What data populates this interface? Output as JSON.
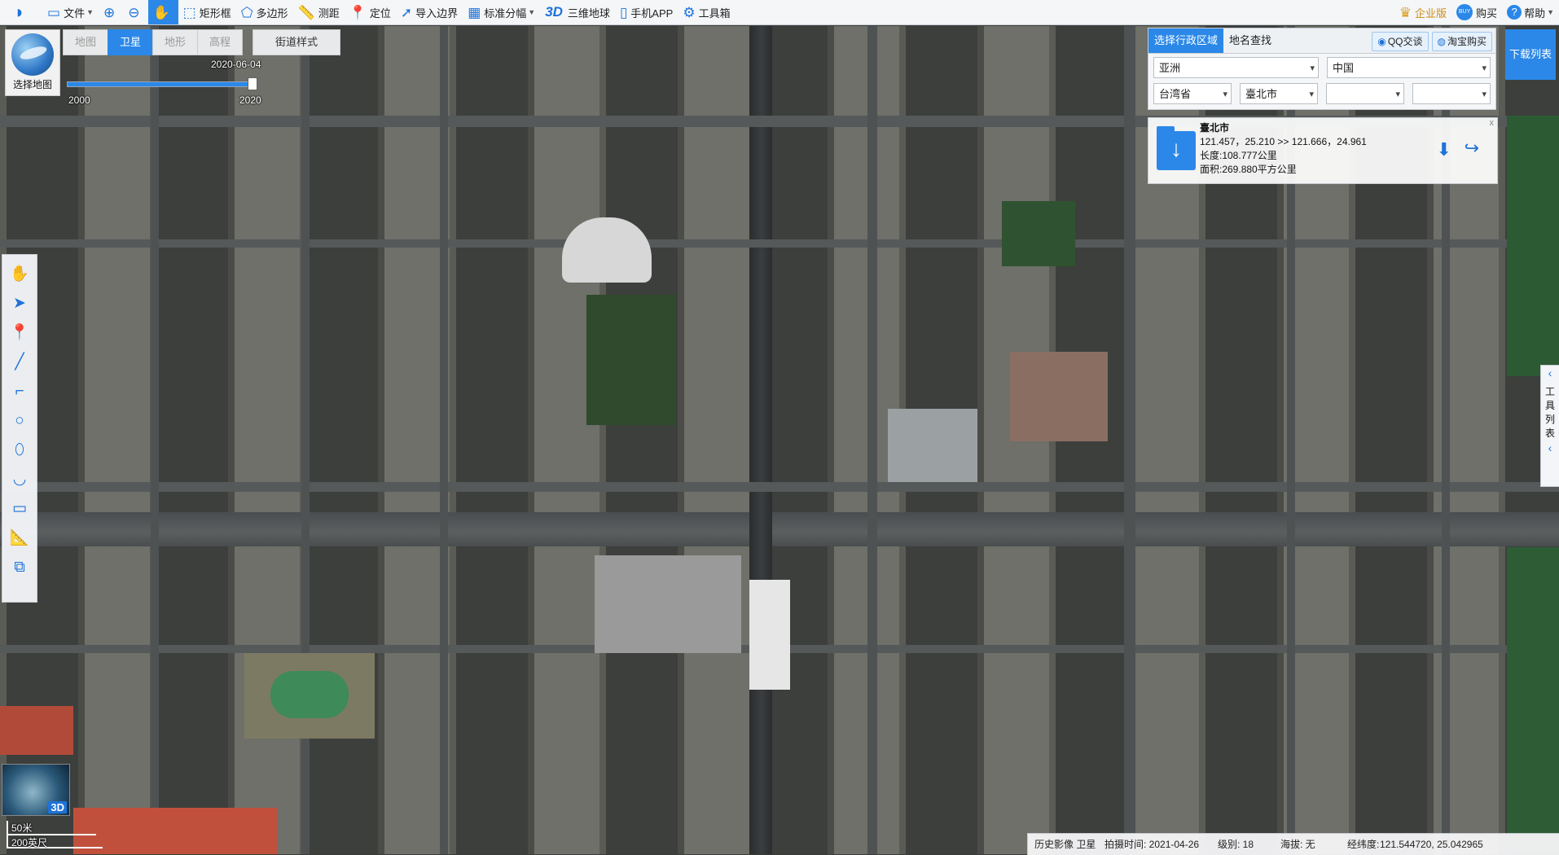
{
  "toolbar": {
    "file": "文件",
    "zoom_in": "",
    "zoom_out": "",
    "rect_frame": "矩形框",
    "polygon": "多边形",
    "measure": "测距",
    "locate": "定位",
    "import_boundary": "导入边界",
    "standard_grid": "标准分幅",
    "threeD_badge": "3D",
    "threeD_globe": "三维地球",
    "mobile_app": "手机APP",
    "toolbox": "工具箱",
    "enterprise": "企业版",
    "buy_badge": "BUY",
    "buy": "购买",
    "help": "帮助"
  },
  "map_selector": {
    "label": "选择地图"
  },
  "map_tabs": [
    "地图",
    "卫星",
    "地形",
    "高程"
  ],
  "active_map_tab": "卫星",
  "street_style": "街道样式",
  "timeline": {
    "current_date": "2020-06-04",
    "start_year": "2000",
    "end_year": "2020",
    "position": 1.0
  },
  "left_tools": [
    "hand-icon",
    "pointer-icon",
    "marker-icon",
    "line-icon",
    "polyline-icon",
    "circle-icon",
    "ellipse-icon",
    "curve-icon",
    "rectangle-icon",
    "ruler-icon",
    "area-icon"
  ],
  "region_panel": {
    "tab_region": "选择行政区域",
    "tab_place": "地名查找",
    "qq_chat": "QQ交谈",
    "taobao": "淘宝购买",
    "continent": "亚洲",
    "country": "中国",
    "province": "台湾省",
    "city": "臺北市",
    "district": "",
    "town": ""
  },
  "info_card": {
    "name": "臺北市",
    "coords": "121.457，25.210 >> 121.666，24.961",
    "length": "长度:108.777公里",
    "area": "面积:269.880平方公里",
    "close": "x"
  },
  "download_list": "下载列表",
  "side_tools": {
    "label": "工具列表",
    "arrow_up": "‹",
    "arrow_down": "‹"
  },
  "overview": {
    "badge": "3D"
  },
  "scale": {
    "metric": "50米",
    "imperial": "200英尺"
  },
  "statusbar": {
    "history": "历史影像 卫星",
    "capture_time": "拍摄时间: 2021-04-26",
    "level": "级别:  18",
    "altitude": "海拔: 无",
    "lonlat_label": "经纬度:",
    "lonlat": "121.544720, 25.042965"
  },
  "colors": {
    "accent": "#2b88e8",
    "toolbar_bg": "#f4f6f8",
    "panel_border": "#c7ccd2"
  }
}
